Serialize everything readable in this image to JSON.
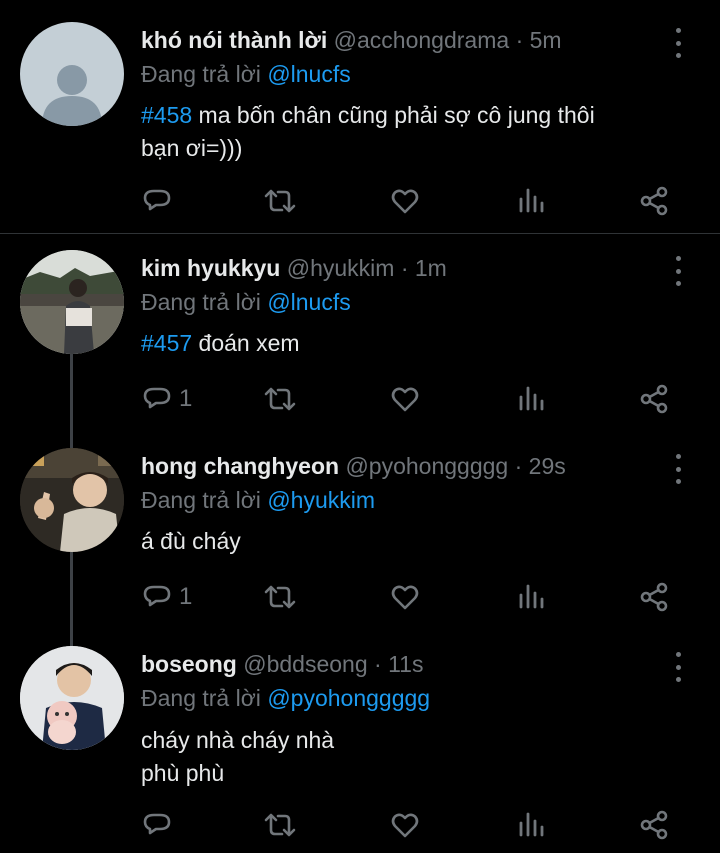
{
  "tweets": [
    {
      "name": "khó nói thành lời",
      "handle": "@acchongdrama",
      "sep": "·",
      "time": "5m",
      "reply_prefix": "Đang trả lời",
      "reply_to": "@lnucfs",
      "tag": "#458",
      "text_after_tag": " ma bốn chân cũng phải sợ cô jung thôi",
      "text_line2": "bạn ơi=)))",
      "reply_count": ""
    },
    {
      "name": "kim hyukkyu",
      "handle": "@hyukkim",
      "sep": "·",
      "time": "1m",
      "reply_prefix": "Đang trả lời",
      "reply_to": "@lnucfs",
      "tag": "#457",
      "text_after_tag": " đoán xem",
      "reply_count": "1"
    },
    {
      "name": "hong changhyeon",
      "handle": "@pyohonggggg",
      "sep": "·",
      "time": "29s",
      "reply_prefix": "Đang trả lời",
      "reply_to": "@hyukkim",
      "text": "á đù cháy",
      "reply_count": "1"
    },
    {
      "name": "boseong",
      "handle": "@bddseong",
      "sep": "·",
      "time": "11s",
      "reply_prefix": "Đang trả lời",
      "reply_to": "@pyohonggggg",
      "text": "cháy nhà cháy nhà",
      "text_line2": "phù phù",
      "reply_count": ""
    }
  ],
  "icons": [
    "reply-icon",
    "retweet-icon",
    "like-icon",
    "analytics-icon",
    "share-icon",
    "more-icon"
  ],
  "colors": {
    "background": "#000000",
    "text": "#e7e9ea",
    "muted": "#71767b",
    "accent": "#1d9bf0"
  }
}
